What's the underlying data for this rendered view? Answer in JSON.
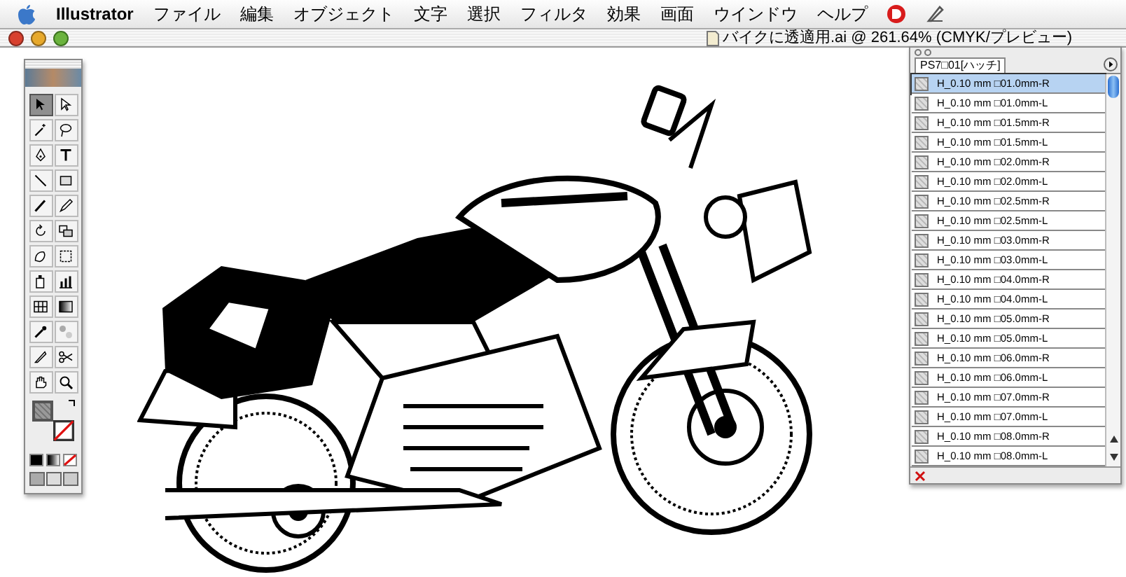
{
  "menubar": {
    "app": "Illustrator",
    "menus": [
      "ファイル",
      "編集",
      "オブジェクト",
      "文字",
      "選択",
      "フィルタ",
      "効果",
      "画面",
      "ウインドウ",
      "ヘルプ"
    ]
  },
  "document": {
    "title": "バイクに透適用.ai @ 261.64% (CMYK/プレビュー)"
  },
  "toolbox": {
    "tools": [
      {
        "kind": "selection",
        "selected": true
      },
      {
        "kind": "direct-selection",
        "selected": false
      },
      {
        "kind": "magic-wand",
        "selected": false
      },
      {
        "kind": "lasso",
        "selected": false
      },
      {
        "kind": "pen",
        "selected": false
      },
      {
        "kind": "type",
        "selected": false
      },
      {
        "kind": "line",
        "selected": false
      },
      {
        "kind": "rectangle",
        "selected": false
      },
      {
        "kind": "paintbrush",
        "selected": false
      },
      {
        "kind": "pencil",
        "selected": false
      },
      {
        "kind": "rotate",
        "selected": false
      },
      {
        "kind": "scale",
        "selected": false
      },
      {
        "kind": "warp",
        "selected": false
      },
      {
        "kind": "free-transform",
        "selected": false
      },
      {
        "kind": "symbol-sprayer",
        "selected": false
      },
      {
        "kind": "graph",
        "selected": false
      },
      {
        "kind": "mesh",
        "selected": false
      },
      {
        "kind": "gradient",
        "selected": false
      },
      {
        "kind": "eyedropper",
        "selected": false
      },
      {
        "kind": "blend",
        "selected": false
      },
      {
        "kind": "slice",
        "selected": false
      },
      {
        "kind": "scissors",
        "selected": false
      },
      {
        "kind": "hand",
        "selected": false
      },
      {
        "kind": "zoom",
        "selected": false
      }
    ]
  },
  "swatches_panel": {
    "tab": "PS7□01[ハッチ]",
    "swatches": [
      {
        "name": "H_0.10 mm □01.0mm-R",
        "selected": true
      },
      {
        "name": "H_0.10 mm □01.0mm-L",
        "selected": false
      },
      {
        "name": "H_0.10 mm □01.5mm-R",
        "selected": false
      },
      {
        "name": "H_0.10 mm □01.5mm-L",
        "selected": false
      },
      {
        "name": "H_0.10 mm □02.0mm-R",
        "selected": false
      },
      {
        "name": "H_0.10 mm □02.0mm-L",
        "selected": false
      },
      {
        "name": "H_0.10 mm □02.5mm-R",
        "selected": false
      },
      {
        "name": "H_0.10 mm □02.5mm-L",
        "selected": false
      },
      {
        "name": "H_0.10 mm □03.0mm-R",
        "selected": false
      },
      {
        "name": "H_0.10 mm □03.0mm-L",
        "selected": false
      },
      {
        "name": "H_0.10 mm □04.0mm-R",
        "selected": false
      },
      {
        "name": "H_0.10 mm □04.0mm-L",
        "selected": false
      },
      {
        "name": "H_0.10 mm □05.0mm-R",
        "selected": false
      },
      {
        "name": "H_0.10 mm □05.0mm-L",
        "selected": false
      },
      {
        "name": "H_0.10 mm □06.0mm-R",
        "selected": false
      },
      {
        "name": "H_0.10 mm □06.0mm-L",
        "selected": false
      },
      {
        "name": "H_0.10 mm □07.0mm-R",
        "selected": false
      },
      {
        "name": "H_0.10 mm □07.0mm-L",
        "selected": false
      },
      {
        "name": "H_0.10 mm □08.0mm-R",
        "selected": false
      },
      {
        "name": "H_0.10 mm □08.0mm-L",
        "selected": false
      }
    ]
  }
}
